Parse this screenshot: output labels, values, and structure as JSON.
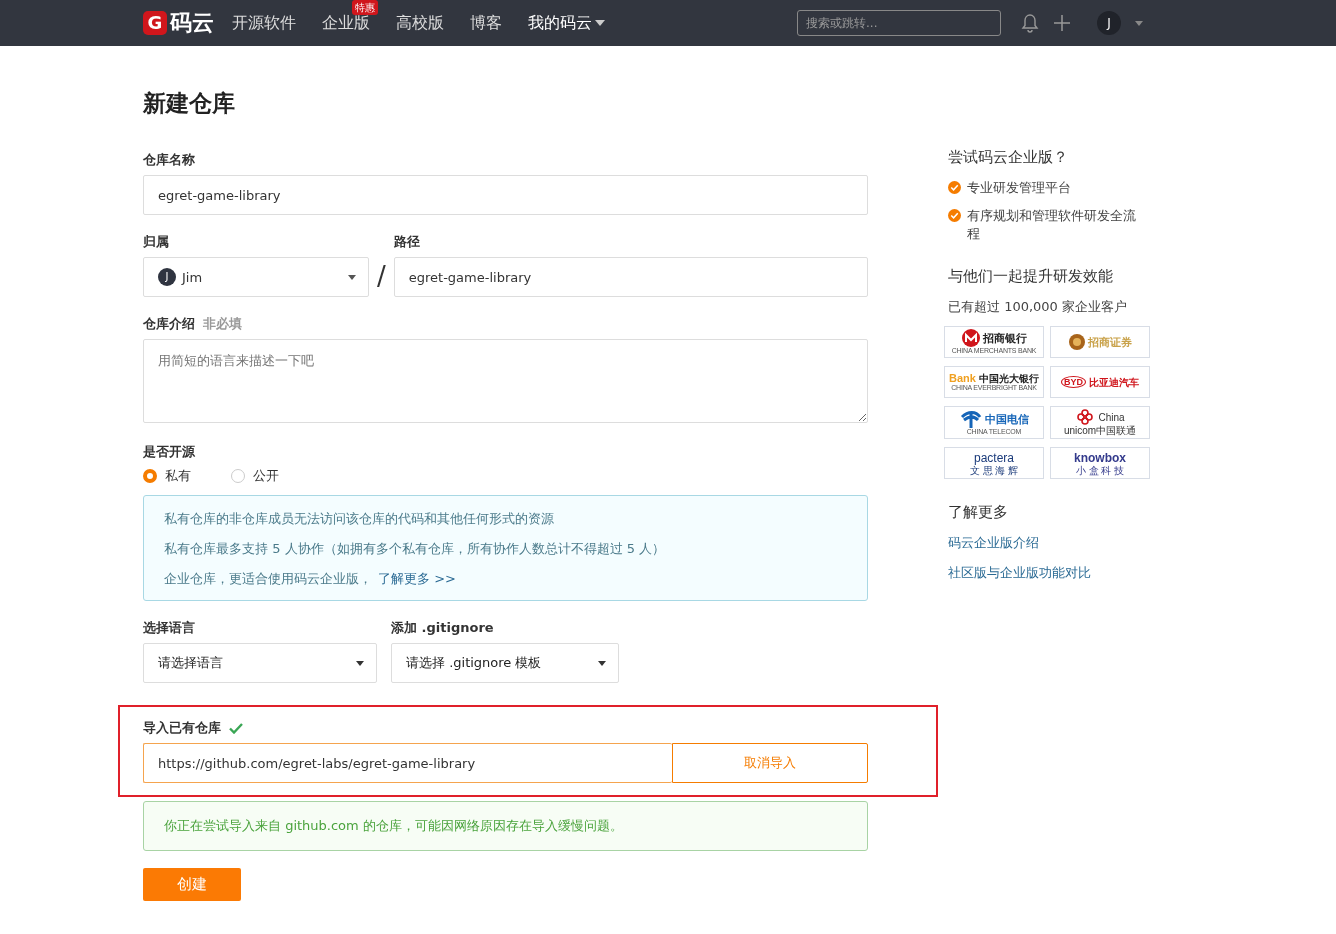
{
  "topbar": {
    "logo_mark": "G",
    "logo_text": "码云",
    "nav": [
      {
        "label": "开源软件",
        "dropdown": false
      },
      {
        "label": "企业版",
        "badge": "特惠",
        "dropdown": false
      },
      {
        "label": "高校版",
        "dropdown": false
      },
      {
        "label": "博客",
        "dropdown": false
      },
      {
        "label": "我的码云",
        "dropdown": true
      }
    ],
    "search": {
      "placeholder": "搜索或跳转..."
    },
    "avatar": "J"
  },
  "page_title": "新建仓库",
  "form": {
    "name": {
      "label": "仓库名称",
      "value": "egret-game-library"
    },
    "owner": {
      "label": "归属",
      "avatar": "J",
      "value": "Jim"
    },
    "separator": "/",
    "path": {
      "label": "路径",
      "value": "egret-game-library"
    },
    "description": {
      "label": "仓库介绍",
      "optional": "非必填",
      "placeholder": "用简短的语言来描述一下吧"
    },
    "visibility": {
      "label": "是否开源",
      "options": [
        {
          "label": "私有",
          "selected": true
        },
        {
          "label": "公开",
          "selected": false
        }
      ]
    },
    "info": {
      "lines": [
        "私有仓库的非仓库成员无法访问该仓库的代码和其他任何形式的资源",
        "私有仓库最多支持 5 人协作（如拥有多个私有仓库，所有协作人数总计不得超过 5 人）"
      ],
      "last_line": "企业仓库，更适合使用码云企业版，",
      "link": "了解更多 >>"
    },
    "language": {
      "label": "选择语言",
      "value": "请选择语言"
    },
    "gitignore": {
      "label": "添加 .gitignore",
      "value": "请选择 .gitignore 模板"
    },
    "import": {
      "label": "导入已有仓库",
      "valid": true,
      "value": "https://github.com/egret-labs/egret-game-library",
      "cancel": "取消导入"
    },
    "notice": "你正在尝试导入来自 github.com 的仓库，可能因网络原因存在导入缓慢问题。",
    "submit": "创建"
  },
  "sidebar": {
    "trial_title": "尝试码云企业版？",
    "features": [
      "专业研发管理平台",
      "有序规划和管理软件研发全流程"
    ],
    "clients_title": "与他们一起提升研发效能",
    "clients_count": "已有超过 100,000 家企业客户",
    "logos": [
      {
        "kind": "cmb",
        "name": "招商银行",
        "sub": "CHINA MERCHANTS BANK"
      },
      {
        "kind": "cms",
        "name": "招商证券"
      },
      {
        "kind": "ceb",
        "name": "中国光大银行",
        "sub": "CHINA EVERBRIGHT BANK",
        "mark": "Bank"
      },
      {
        "kind": "byd",
        "name": "比亚迪汽车",
        "mark": "BYD"
      },
      {
        "kind": "telecom",
        "name": "中国电信",
        "sub": "CHINA TELECOM"
      },
      {
        "kind": "unicom",
        "name": "unicom中国联通",
        "mark": "China"
      },
      {
        "kind": "pactera",
        "name": "文 思 海 辉",
        "mark": "pactera"
      },
      {
        "kind": "knowbox",
        "name": "小 盒 科 技",
        "mark": "knowbox"
      }
    ],
    "more_title": "了解更多",
    "links": [
      "码云企业版介绍",
      "社区版与企业版功能对比"
    ]
  }
}
